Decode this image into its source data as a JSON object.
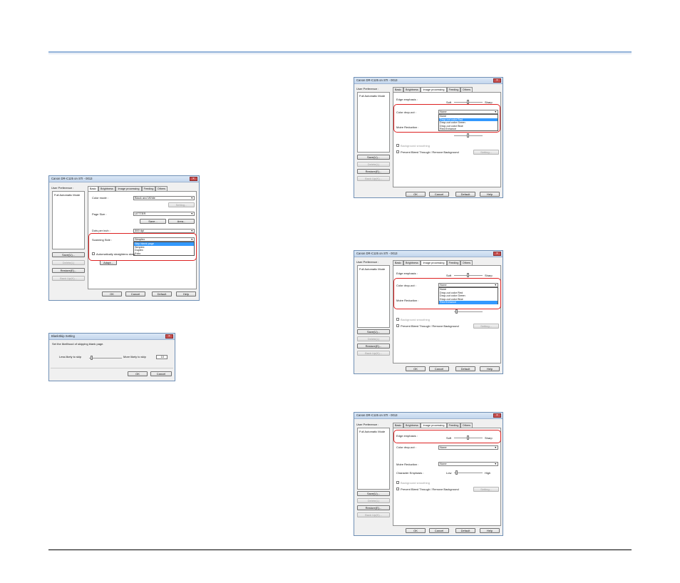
{
  "dialog": {
    "title": "Canon DR-C125 on STI - 0013",
    "user_preference": "User Preference :",
    "mode_item": "Full Automatic Mode",
    "save": "Save(U)...",
    "delete": "Delete(L)",
    "restore": "Restore(E)...",
    "back_up": "Back Up(K)...",
    "ok": "OK",
    "cancel": "Cancel",
    "default": "Default",
    "help": "Help",
    "tabs": [
      "Basic",
      "Brightness",
      "Image processing",
      "Feeding",
      "Others"
    ],
    "edge_emphasis": "Edge emphasis :",
    "soft": "Soft",
    "sharp": "Sharp",
    "color_dropout": "Color drop-out :",
    "moire": "Moire Reduction :",
    "character_emphasis": "Character Emphasis :",
    "low": "Low",
    "high": "High",
    "none": "None",
    "dropout_options": [
      "None",
      "Drop-out color Red",
      "Drop-out color Green",
      "Drop-out color Blue",
      "Red Enhance"
    ],
    "bg_smoothing": "Background smoothing",
    "bleed": "Prevent Bleed Through / Remove Background",
    "setting": "Setting..."
  },
  "basic_dialog": {
    "color_mode": "Color mode :",
    "color_mode_value": "Black and White",
    "setting": "Setting...",
    "page_size": "Page Size :",
    "page_size_value": "LETTER",
    "save": "Save...",
    "area": "Area...",
    "dpi": "Dots per inch :",
    "dpi_value": "300 dpi",
    "scanning_side": "Scanning Side :",
    "scanning_side_value": "Simplex",
    "side_options": [
      "Skip blank page",
      "Simplex",
      "Duplex",
      "Folio"
    ],
    "straighten": "Automatically straightens skew",
    "adapt": "Adapt..."
  },
  "blankskip": {
    "title": "BlankSkip Setting",
    "desc": "Set the likelihood of skipping blank page.",
    "less": "Less likely to skip",
    "more": "More likely to skip",
    "value": "10",
    "ok": "OK",
    "cancel": "Cancel"
  },
  "colors": {
    "highlight": "#dd2222",
    "selection": "#3399ff",
    "rule": "#8fb0d8"
  }
}
